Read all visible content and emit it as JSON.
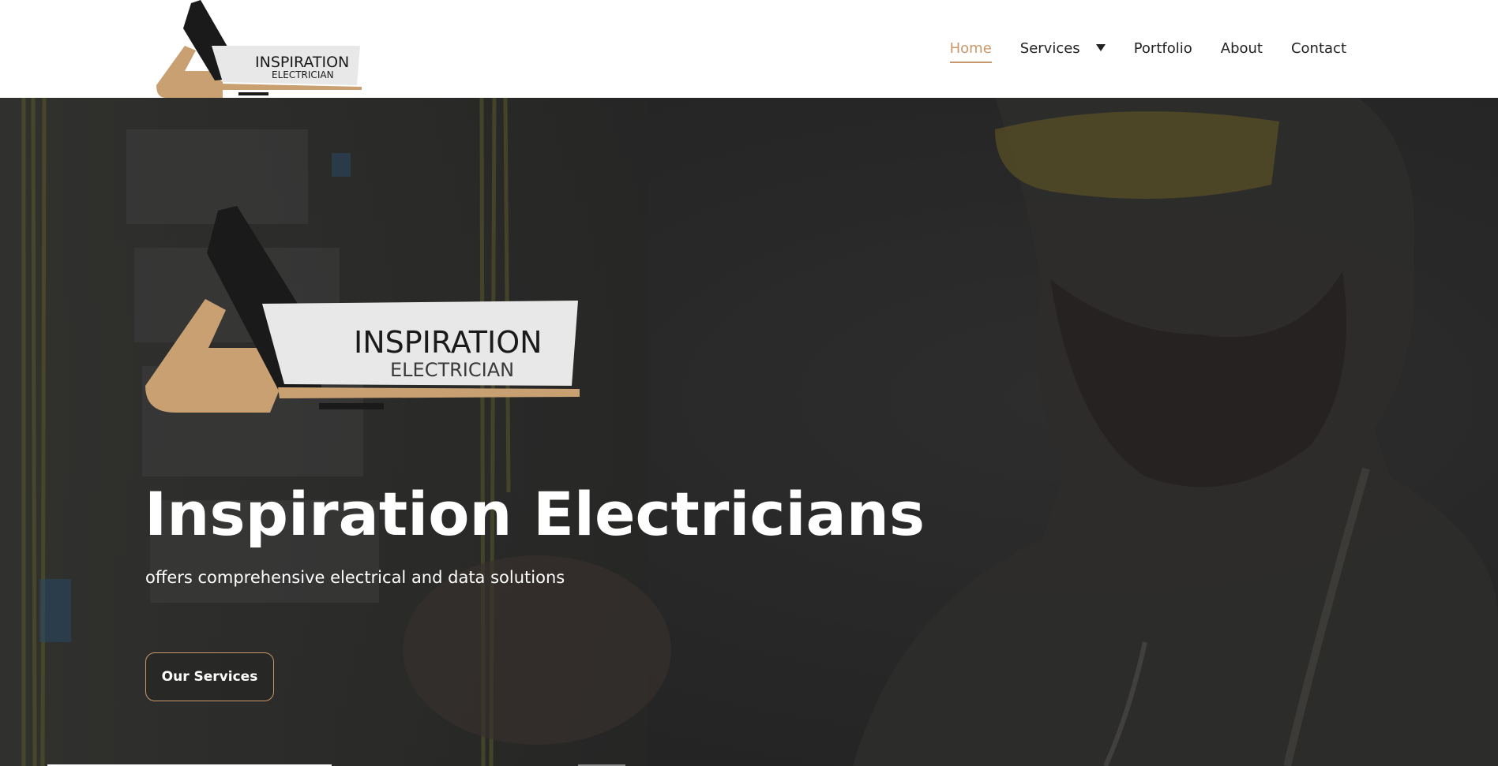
{
  "brand": {
    "logo_word_1": "INSPIRATION",
    "logo_word_2": "ELECTRICIAN"
  },
  "nav": {
    "items": [
      {
        "label": "Home",
        "active": true
      },
      {
        "label": "Services",
        "active": false,
        "has_dropdown": true
      },
      {
        "label": "Portfolio",
        "active": false
      },
      {
        "label": "About",
        "active": false
      },
      {
        "label": "Contact",
        "active": false
      }
    ]
  },
  "hero": {
    "title": "Inspiration Electricians",
    "subtitle": "offers comprehensive electrical and data solutions",
    "cta_label": "Our Services"
  },
  "colors": {
    "accent": "#c9986a",
    "logo_dark": "#1a1a1a",
    "logo_panel": "#e6e6e6",
    "nav_text": "#222222"
  },
  "icons": {
    "dropdown": "caret-down-icon"
  }
}
